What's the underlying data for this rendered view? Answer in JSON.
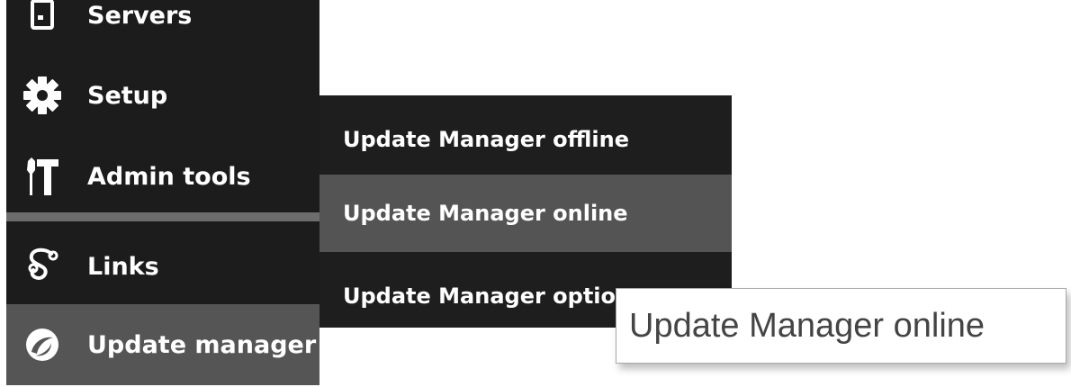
{
  "colors": {
    "sidebar_bg": "#1c1c1c",
    "sidebar_active_bg": "#555555",
    "divider": "#6c6c6c",
    "submenu_bg": "#1e1e1e",
    "submenu_hover_bg": "#545454",
    "text": "#ffffff",
    "tooltip_text": "#444444"
  },
  "sidebar": {
    "items": [
      {
        "label": "Servers",
        "icon": "server-icon"
      },
      {
        "label": "Setup",
        "icon": "gear-icon"
      },
      {
        "label": "Admin tools",
        "icon": "tools-icon"
      },
      {
        "label": "Links",
        "icon": "link-icon"
      },
      {
        "label": "Update manager",
        "icon": "update-manager-icon",
        "active": true
      }
    ]
  },
  "submenu": {
    "items": [
      {
        "label": "Update Manager offline"
      },
      {
        "label": "Update Manager online",
        "hovered": true
      },
      {
        "label": "Update Manager optio"
      }
    ]
  },
  "tooltip": {
    "text": "Update Manager online"
  }
}
